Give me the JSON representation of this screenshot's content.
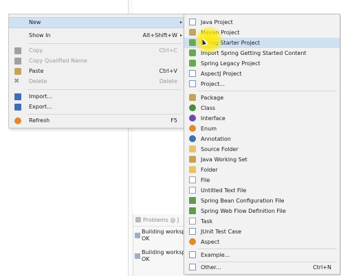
{
  "context_menu": {
    "items": [
      {
        "label": "New",
        "shortcut": "",
        "submenu": true,
        "disabled": false
      },
      {
        "label": "Show In",
        "shortcut": "Alt+Shift+W",
        "submenu": true,
        "disabled": false
      },
      {
        "label": "Copy",
        "shortcut": "Ctrl+C",
        "disabled": true
      },
      {
        "label": "Copy Qualified Name",
        "shortcut": "",
        "disabled": true
      },
      {
        "label": "Paste",
        "shortcut": "Ctrl+V",
        "disabled": false
      },
      {
        "label": "Delete",
        "shortcut": "Delete",
        "disabled": true
      },
      {
        "label": "Import...",
        "shortcut": "",
        "disabled": false
      },
      {
        "label": "Export...",
        "shortcut": "",
        "disabled": false
      },
      {
        "label": "Refresh",
        "shortcut": "F5",
        "disabled": false
      }
    ],
    "submenu_arrow": "▸"
  },
  "new_submenu": {
    "items": [
      {
        "label": "Java Project",
        "icon": "java-project-icon"
      },
      {
        "label": "Maven Project",
        "icon": "maven-project-icon"
      },
      {
        "label": "Spring Starter Project",
        "icon": "spring-starter-icon"
      },
      {
        "label": "Import Spring Getting Started Content",
        "icon": "spring-import-icon"
      },
      {
        "label": "Spring Legacy Project",
        "icon": "spring-legacy-icon"
      },
      {
        "label": "AspectJ Project",
        "icon": "aspectj-project-icon"
      },
      {
        "label": "Project...",
        "icon": "project-icon"
      },
      {
        "label": "Package",
        "icon": "package-icon"
      },
      {
        "label": "Class",
        "icon": "class-icon"
      },
      {
        "label": "Interface",
        "icon": "interface-icon"
      },
      {
        "label": "Enum",
        "icon": "enum-icon"
      },
      {
        "label": "Annotation",
        "icon": "annotation-icon"
      },
      {
        "label": "Source Folder",
        "icon": "source-folder-icon"
      },
      {
        "label": "Java Working Set",
        "icon": "working-set-icon"
      },
      {
        "label": "Folder",
        "icon": "folder-icon"
      },
      {
        "label": "File",
        "icon": "file-icon"
      },
      {
        "label": "Untitled Text File",
        "icon": "text-file-icon"
      },
      {
        "label": "Spring Bean Configuration File",
        "icon": "spring-bean-icon"
      },
      {
        "label": "Spring Web Flow Definition File",
        "icon": "spring-webflow-icon"
      },
      {
        "label": "Task",
        "icon": "task-icon"
      },
      {
        "label": "JUnit Test Case",
        "icon": "junit-icon"
      },
      {
        "label": "Aspect",
        "icon": "aspect-icon"
      },
      {
        "label": "Example...",
        "icon": "example-icon"
      },
      {
        "label": "Other...",
        "icon": "other-icon",
        "shortcut": "Ctrl+N"
      }
    ]
  },
  "problems_panel": {
    "tab_label": "Problems",
    "tab_extra": "@ J",
    "rows": [
      {
        "title": "Building worksp",
        "status": "OK"
      },
      {
        "title": "Building worksp",
        "status": "OK"
      }
    ]
  },
  "colors": {
    "menu_bg": "#f0f0f0",
    "highlight": "#d0e1f4",
    "cursor_highlight": "#ffeb00"
  }
}
